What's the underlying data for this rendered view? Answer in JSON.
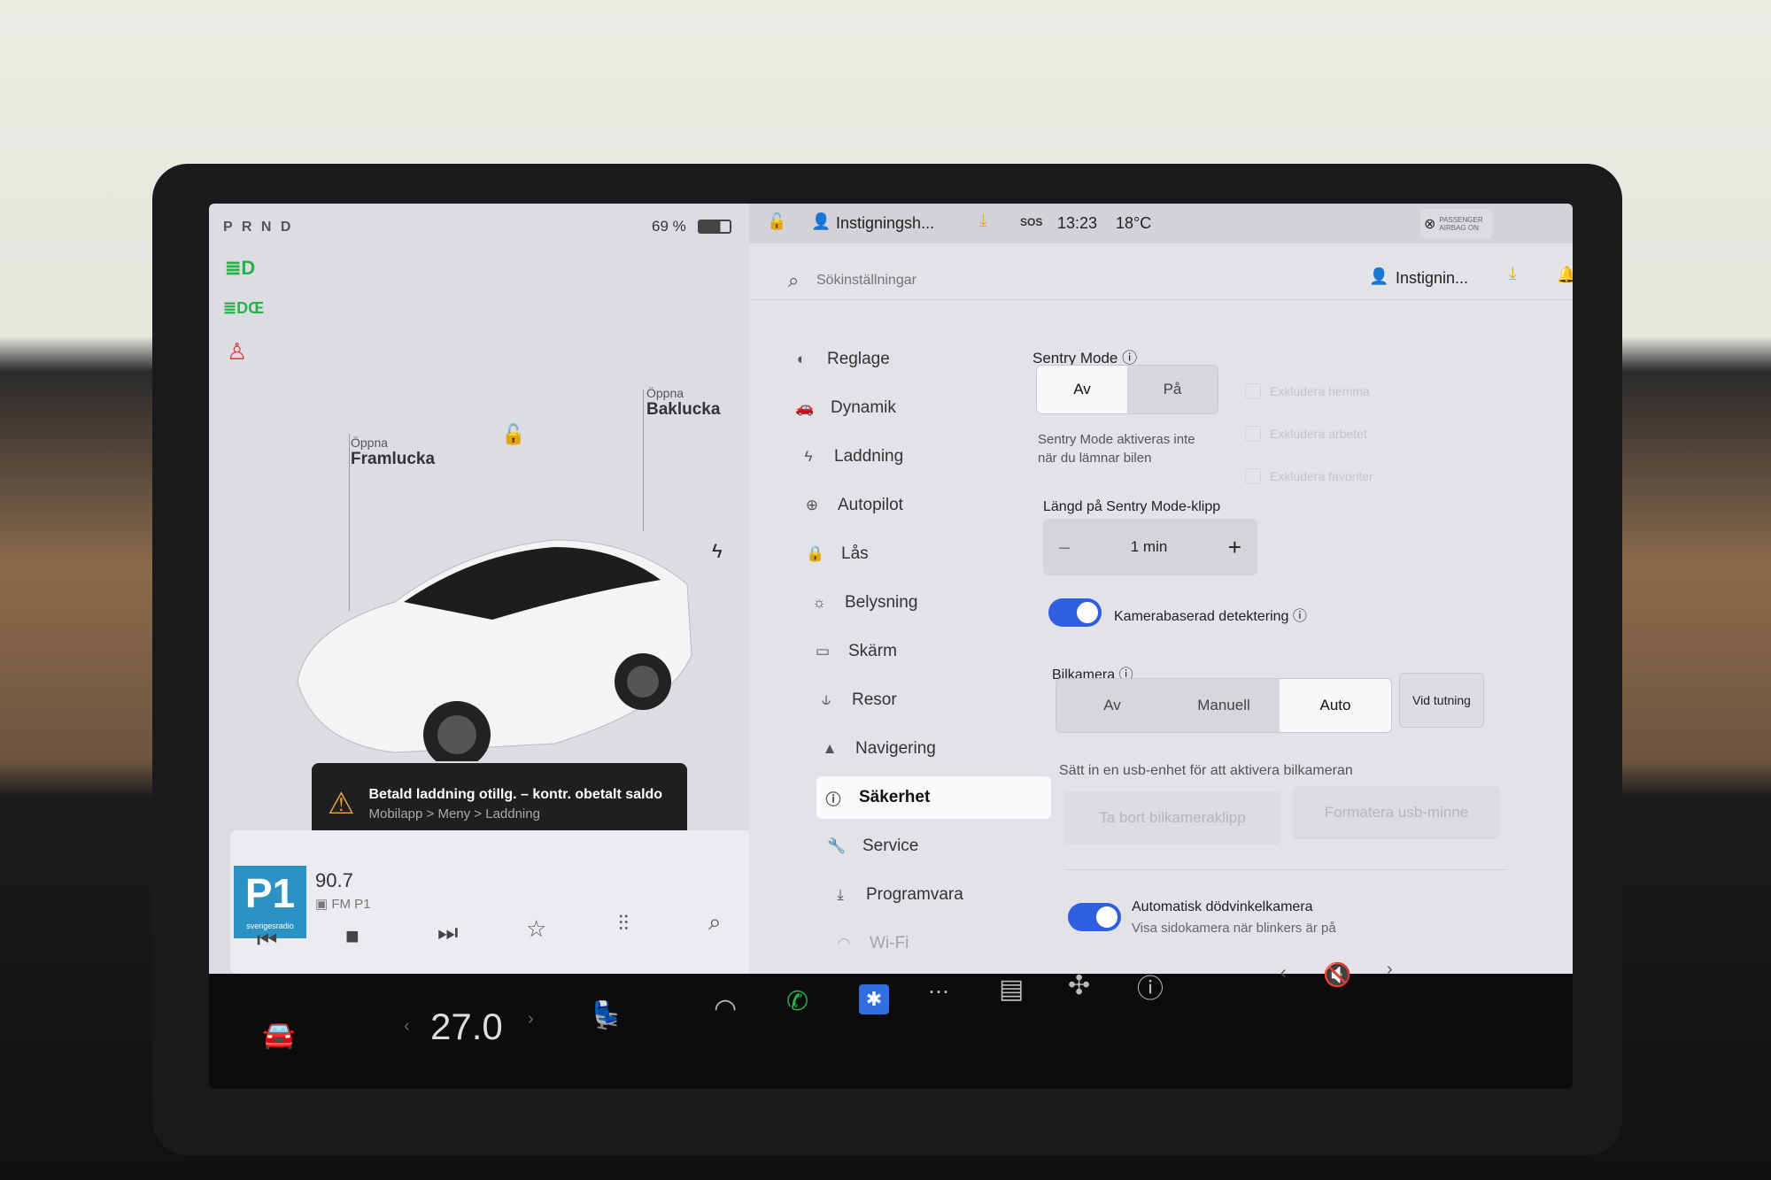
{
  "left": {
    "gear": "P R N D",
    "battery": "69 %",
    "frunk": {
      "small": "Öppna",
      "label": "Framlucka"
    },
    "trunk": {
      "small": "Öppna",
      "label": "Baklucka"
    },
    "alert": {
      "title": "Betald laddning otillg. – kontr. obetalt saldo",
      "subtitle": "Mobilapp > Meny > Laddning"
    },
    "media": {
      "frequency": "90.7",
      "station": "FM P1",
      "logo_text": "P1",
      "logo_sub": "sverigesradio"
    }
  },
  "status": {
    "profile": "Instigningsh...",
    "time": "13:23",
    "temp": "18°C",
    "sos": "SOS",
    "airbag": "PASSENGER AIRBAG ON"
  },
  "header": {
    "search_placeholder": "Sökinställningar",
    "profile": "Instignin..."
  },
  "menu": [
    {
      "label": "Reglage",
      "icon": "toggle-icon"
    },
    {
      "label": "Dynamik",
      "icon": "car-icon"
    },
    {
      "label": "Laddning",
      "icon": "bolt-icon"
    },
    {
      "label": "Autopilot",
      "icon": "steering-wheel-icon"
    },
    {
      "label": "Lås",
      "icon": "lock-icon"
    },
    {
      "label": "Belysning",
      "icon": "sun-icon"
    },
    {
      "label": "Skärm",
      "icon": "display-icon"
    },
    {
      "label": "Resor",
      "icon": "trips-icon"
    },
    {
      "label": "Navigering",
      "icon": "navigation-icon"
    },
    {
      "label": "Säkerhet",
      "icon": "alert-circle-icon",
      "selected": true
    },
    {
      "label": "Service",
      "icon": "wrench-icon"
    },
    {
      "label": "Programvara",
      "icon": "download-icon"
    },
    {
      "label": "Wi-Fi",
      "icon": "wifi-icon"
    }
  ],
  "content": {
    "sentry_title": "Sentry Mode",
    "sentry_options": [
      "Av",
      "På"
    ],
    "sentry_selected": "Av",
    "exclude": [
      "Exkludera hemma",
      "Exkludera arbetet",
      "Exkludera favoriter"
    ],
    "sentry_desc_1": "Sentry Mode aktiveras inte",
    "sentry_desc_2": "när du lämnar bilen",
    "clip_title": "Längd på Sentry Mode-klipp",
    "clip_value": "1 min",
    "minus": "–",
    "plus": "+",
    "camera_detection": "Kamerabaserad detektering",
    "camera_detection_on": true,
    "dashcam_title": "Bilkamera",
    "dashcam_options": [
      "Av",
      "Manuell",
      "Auto"
    ],
    "dashcam_selected": "Auto",
    "honk": "Vid tutning",
    "usb_msg": "Sätt in en usb-enhet för att aktivera bilkameran",
    "delete_clips": "Ta bort bilkameraklipp",
    "format_usb": "Formatera usb-minne",
    "blindspot_title": "Automatisk dödvinkelkamera",
    "blindspot_desc": "Visa sidokamera när blinkers är på",
    "blindspot_on": true
  },
  "bottom": {
    "temperature": "27.0"
  },
  "colors": {
    "accent": "#2f5fe0",
    "warning": "#e8a33a",
    "download": "#e8a33a"
  }
}
